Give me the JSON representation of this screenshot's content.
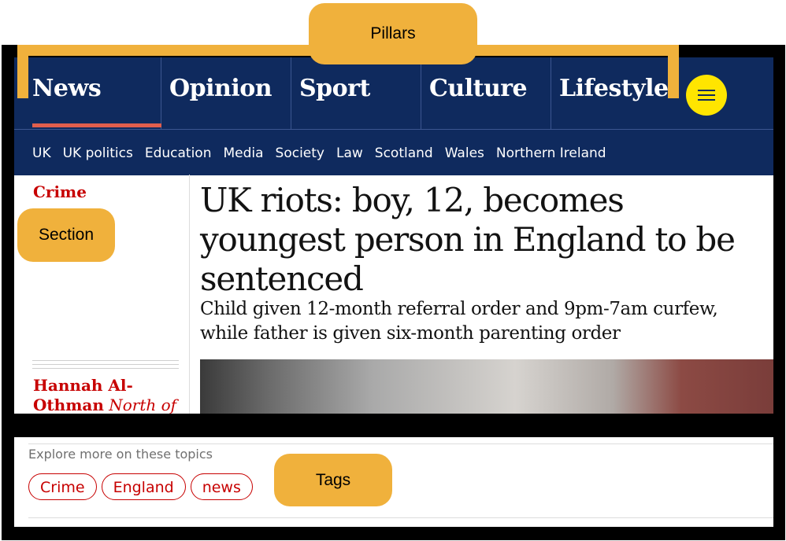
{
  "pillars": [
    "News",
    "Opinion",
    "Sport",
    "Culture",
    "Lifestyle"
  ],
  "subnav": [
    "UK",
    "UK politics",
    "Education",
    "Media",
    "Society",
    "Law",
    "Scotland",
    "Wales",
    "Northern Ireland"
  ],
  "article": {
    "section": "Crime",
    "headline": "UK riots: boy, 12, becomes youngest person in England to be sentenced",
    "standfirst": "Child given 12-month referral order and 9pm-7am curfew, while father is given six-month parenting order",
    "byline_name": "Hannah Al-Othman",
    "byline_title": "North of"
  },
  "topics": {
    "label": "Explore more on these topics",
    "tags": [
      "Crime",
      "England",
      "news"
    ]
  },
  "annotations": {
    "pillars": "Pillars",
    "section": "Section",
    "tags": "Tags"
  },
  "colors": {
    "nav_background": "#0f2a5e",
    "accent_red": "#c70000",
    "underline": "#e05e4d",
    "menu_button": "#ffe500",
    "callout": "#f0b13c"
  },
  "icons": {
    "menu": "hamburger-menu-icon"
  }
}
